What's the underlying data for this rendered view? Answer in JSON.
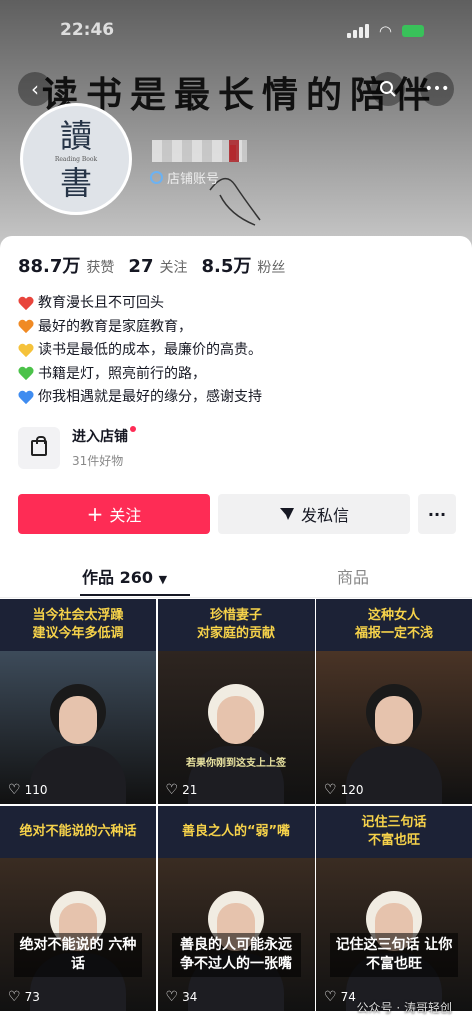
{
  "status": {
    "time": "22:46"
  },
  "banner": {
    "title": "读书是最长情的陪伴"
  },
  "avatar": {
    "line1": "讀",
    "small": "Reading Book",
    "line2": "書"
  },
  "profile": {
    "shop_tag": "店铺账号"
  },
  "stats": [
    {
      "num": "88.7万",
      "label": "获赞"
    },
    {
      "num": "27",
      "label": "关注"
    },
    {
      "num": "8.5万",
      "label": "粉丝"
    }
  ],
  "bio": [
    {
      "color": "#e8453c",
      "text": "教育漫长且不可回头"
    },
    {
      "color": "#f08a24",
      "text": "最好的教育是家庭教育，"
    },
    {
      "color": "#f5c23b",
      "text": "读书是最低的成本，最廉价的高贵。"
    },
    {
      "color": "#4cc24a",
      "text": "书籍是灯，照亮前行的路，"
    },
    {
      "color": "#3f8cf0",
      "text": "你我相遇就是最好的缘分，感谢支持"
    }
  ],
  "shop": {
    "title": "进入店铺",
    "subtitle": "31件好物"
  },
  "actions": {
    "follow": "关注",
    "message": "发私信",
    "more": "···"
  },
  "tabs": {
    "works": "作品 260",
    "goods": "商品"
  },
  "videos": [
    {
      "cap1": "当今社会太浮躁",
      "cap2": "建议今年多低调",
      "likes": "110",
      "hair": "#1a1a1a",
      "bg": "#3d4b5a",
      "sub": ""
    },
    {
      "cap1": "珍惜妻子",
      "cap2": "对家庭的贡献",
      "likes": "21",
      "hair": "#f1ece2",
      "bg": "#2e2520",
      "sub": "若果你刚到这支上上签"
    },
    {
      "cap1": "这种女人",
      "cap2": "福报一定不浅",
      "likes": "120",
      "hair": "#1a1a1a",
      "bg": "#4a3426",
      "sub": ""
    },
    {
      "cap1": "绝对不能说的六种话",
      "cap2": "",
      "likes": "73",
      "hair": "#f1ece2",
      "bg": "#3a2c22",
      "sub": "绝对不能说的 六种话"
    },
    {
      "cap1": "善良之人的“弱”嘴",
      "cap2": "",
      "likes": "34",
      "hair": "#f1ece2",
      "bg": "#3a2c22",
      "sub": "善良的人可能永远 争不过人的一张嘴"
    },
    {
      "cap1": "记住三句话",
      "cap2": "不富也旺",
      "likes": "74",
      "hair": "#f1ece2",
      "bg": "#3a2c22",
      "sub": "记住这三句话 让你不富也旺"
    }
  ],
  "watermark": "公众号 · 涛哥轻创"
}
